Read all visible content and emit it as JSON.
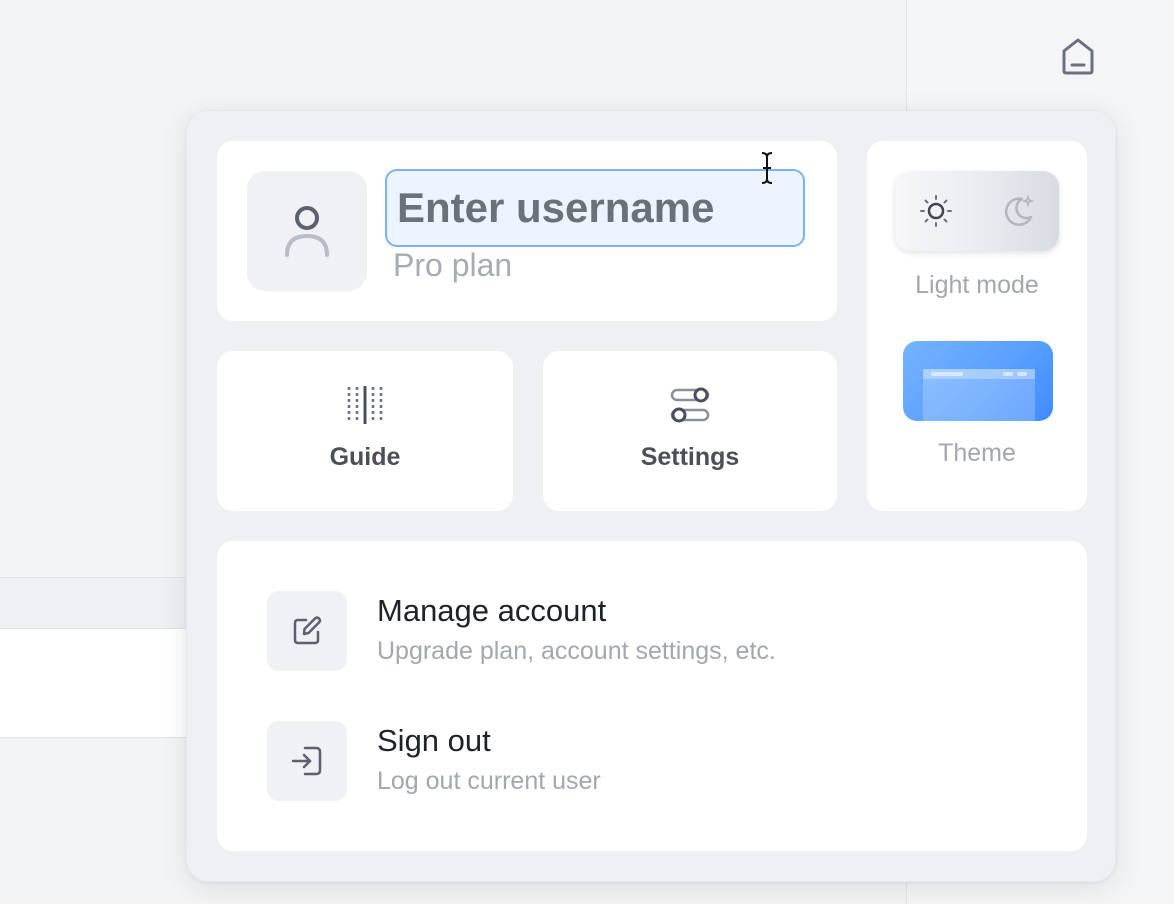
{
  "header": {
    "home_icon": "home-icon"
  },
  "profile": {
    "avatar_icon": "user-icon",
    "username_placeholder": "Enter username",
    "plan": "Pro plan"
  },
  "tiles": [
    {
      "label": "Guide",
      "icon": "guide-icon"
    },
    {
      "label": "Settings",
      "icon": "toggles-icon"
    }
  ],
  "appearance": {
    "mode_label": "Light mode",
    "theme_label": "Theme",
    "light_icon": "sun-icon",
    "dark_icon": "moon-icon",
    "theme_color": "#5aa0ff"
  },
  "actions": [
    {
      "title": "Manage account",
      "subtitle": "Upgrade plan, account settings, etc.",
      "icon": "edit-icon"
    },
    {
      "title": "Sign out",
      "subtitle": "Log out current user",
      "icon": "sign-out-icon"
    }
  ]
}
